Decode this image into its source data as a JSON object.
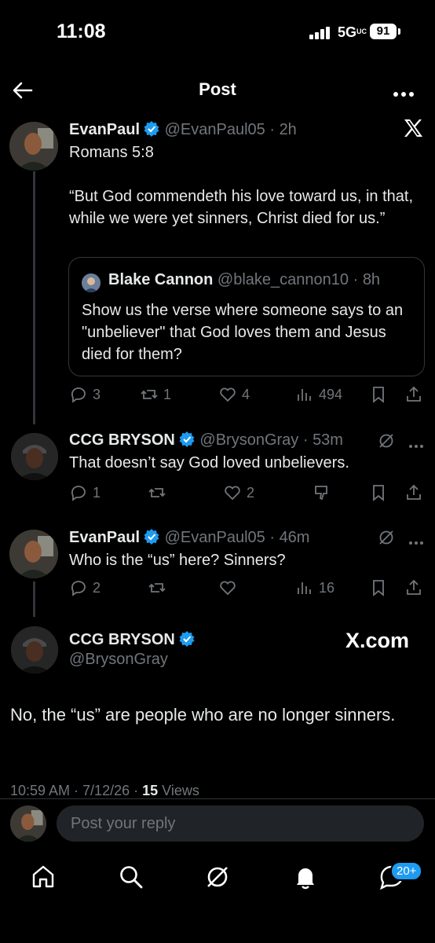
{
  "status_bar": {
    "time": "11:08",
    "network": "5G",
    "network_sub": "UC",
    "battery": "91"
  },
  "header": {
    "title": "Post"
  },
  "post1": {
    "author": "EvanPaul",
    "handle": "@EvanPaul05",
    "time": "2h",
    "text_line1": "Romans 5:8",
    "text_line2": "“But God commendeth his love toward us, in that, while we were yet sinners, Christ died for us.”",
    "quote": {
      "author": "Blake Cannon",
      "handle": "@blake_cannon10",
      "time": "8h",
      "text": "Show us the verse where someone says to an \"unbeliever\" that God loves them and Jesus died for them?"
    },
    "replies": "3",
    "reposts": "1",
    "likes": "4",
    "views": "494"
  },
  "reply1": {
    "author": "CCG BRYSON",
    "handle": "@BrysonGray",
    "time": "53m",
    "text": "That doesn’t say God loved unbelievers.",
    "replies": "1",
    "reposts": "",
    "likes": "2"
  },
  "reply2": {
    "author": "EvanPaul",
    "handle": "@EvanPaul05",
    "time": "46m",
    "text": "Who is the “us” here? Sinners?",
    "replies": "2",
    "reposts": "",
    "likes": "",
    "views": "16"
  },
  "main_post": {
    "author": "CCG BRYSON",
    "handle": "@BrysonGray",
    "source": "X.com",
    "text": "No, the “us” are people who are no longer sinners.",
    "timestamp": "10:59 AM · 7/12/26 ·",
    "views_count": "15",
    "views_label": "Views"
  },
  "reply_box": {
    "placeholder": "Post your reply"
  },
  "bottom_nav": {
    "notifications_badge": "20+"
  },
  "colors": {
    "accent": "#1d9bf0",
    "background": "#000000",
    "muted": "#71767b"
  }
}
